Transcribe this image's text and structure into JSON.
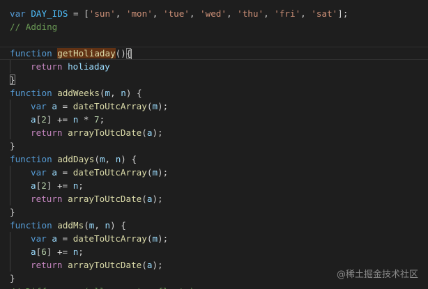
{
  "editor": {
    "language": "javascript",
    "theme": {
      "background": "#1e1e1e",
      "keyword": "#569cd6",
      "function": "#dcdcaa",
      "variable": "#9cdcfe",
      "constant": "#4fc1ff",
      "string": "#ce9178",
      "number": "#b5cea8",
      "comment": "#6a9955"
    },
    "lines": [
      [
        [
          "kw",
          "var"
        ],
        [
          "pun",
          " "
        ],
        [
          "const",
          "DAY_IDS"
        ],
        [
          "pun",
          " = ["
        ],
        [
          "str",
          "'sun'"
        ],
        [
          "pun",
          ", "
        ],
        [
          "str",
          "'mon'"
        ],
        [
          "pun",
          ", "
        ],
        [
          "str",
          "'tue'"
        ],
        [
          "pun",
          ", "
        ],
        [
          "str",
          "'wed'"
        ],
        [
          "pun",
          ", "
        ],
        [
          "str",
          "'thu'"
        ],
        [
          "pun",
          ", "
        ],
        [
          "str",
          "'fri'"
        ],
        [
          "pun",
          ", "
        ],
        [
          "str",
          "'sat'"
        ],
        [
          "pun",
          "];"
        ]
      ],
      [
        [
          "cmt",
          "// Adding"
        ]
      ],
      [],
      [
        [
          "kw",
          "function"
        ],
        [
          "pun",
          " "
        ],
        [
          "fn sel-word",
          "getHoliaday"
        ],
        [
          "pun",
          "()"
        ],
        [
          "pun bracket-match",
          "{"
        ],
        [
          "cursor",
          ""
        ]
      ],
      [
        [
          "indent",
          ""
        ],
        [
          "ctl",
          "return"
        ],
        [
          "pun",
          " "
        ],
        [
          "var",
          "holiaday"
        ]
      ],
      [
        [
          "pun bracket-match",
          "}"
        ]
      ],
      [
        [
          "kw",
          "function"
        ],
        [
          "pun",
          " "
        ],
        [
          "fn",
          "addWeeks"
        ],
        [
          "pun",
          "("
        ],
        [
          "var",
          "m"
        ],
        [
          "pun",
          ", "
        ],
        [
          "var",
          "n"
        ],
        [
          "pun",
          ") {"
        ]
      ],
      [
        [
          "indent",
          ""
        ],
        [
          "kw",
          "var"
        ],
        [
          "pun",
          " "
        ],
        [
          "var",
          "a"
        ],
        [
          "pun",
          " = "
        ],
        [
          "fn",
          "dateToUtcArray"
        ],
        [
          "pun",
          "("
        ],
        [
          "var",
          "m"
        ],
        [
          "pun",
          ");"
        ]
      ],
      [
        [
          "indent",
          ""
        ],
        [
          "var",
          "a"
        ],
        [
          "pun",
          "["
        ],
        [
          "num",
          "2"
        ],
        [
          "pun",
          "] += "
        ],
        [
          "var",
          "n"
        ],
        [
          "pun",
          " * "
        ],
        [
          "num",
          "7"
        ],
        [
          "pun",
          ";"
        ]
      ],
      [
        [
          "indent",
          ""
        ],
        [
          "ctl",
          "return"
        ],
        [
          "pun",
          " "
        ],
        [
          "fn",
          "arrayToUtcDate"
        ],
        [
          "pun",
          "("
        ],
        [
          "var",
          "a"
        ],
        [
          "pun",
          ");"
        ]
      ],
      [
        [
          "pun",
          "}"
        ]
      ],
      [
        [
          "kw",
          "function"
        ],
        [
          "pun",
          " "
        ],
        [
          "fn",
          "addDays"
        ],
        [
          "pun",
          "("
        ],
        [
          "var",
          "m"
        ],
        [
          "pun",
          ", "
        ],
        [
          "var",
          "n"
        ],
        [
          "pun",
          ") {"
        ]
      ],
      [
        [
          "indent",
          ""
        ],
        [
          "kw",
          "var"
        ],
        [
          "pun",
          " "
        ],
        [
          "var",
          "a"
        ],
        [
          "pun",
          " = "
        ],
        [
          "fn",
          "dateToUtcArray"
        ],
        [
          "pun",
          "("
        ],
        [
          "var",
          "m"
        ],
        [
          "pun",
          ");"
        ]
      ],
      [
        [
          "indent",
          ""
        ],
        [
          "var",
          "a"
        ],
        [
          "pun",
          "["
        ],
        [
          "num",
          "2"
        ],
        [
          "pun",
          "] += "
        ],
        [
          "var",
          "n"
        ],
        [
          "pun",
          ";"
        ]
      ],
      [
        [
          "indent",
          ""
        ],
        [
          "ctl",
          "return"
        ],
        [
          "pun",
          " "
        ],
        [
          "fn",
          "arrayToUtcDate"
        ],
        [
          "pun",
          "("
        ],
        [
          "var",
          "a"
        ],
        [
          "pun",
          ");"
        ]
      ],
      [
        [
          "pun",
          "}"
        ]
      ],
      [
        [
          "kw",
          "function"
        ],
        [
          "pun",
          " "
        ],
        [
          "fn",
          "addMs"
        ],
        [
          "pun",
          "("
        ],
        [
          "var",
          "m"
        ],
        [
          "pun",
          ", "
        ],
        [
          "var",
          "n"
        ],
        [
          "pun",
          ") {"
        ]
      ],
      [
        [
          "indent",
          ""
        ],
        [
          "kw",
          "var"
        ],
        [
          "pun",
          " "
        ],
        [
          "var",
          "a"
        ],
        [
          "pun",
          " = "
        ],
        [
          "fn",
          "dateToUtcArray"
        ],
        [
          "pun",
          "("
        ],
        [
          "var",
          "m"
        ],
        [
          "pun",
          ");"
        ]
      ],
      [
        [
          "indent",
          ""
        ],
        [
          "var",
          "a"
        ],
        [
          "pun",
          "["
        ],
        [
          "num",
          "6"
        ],
        [
          "pun",
          "] += "
        ],
        [
          "var",
          "n"
        ],
        [
          "pun",
          ";"
        ]
      ],
      [
        [
          "indent",
          ""
        ],
        [
          "ctl",
          "return"
        ],
        [
          "pun",
          " "
        ],
        [
          "fn",
          "arrayToUtcDate"
        ],
        [
          "pun",
          "("
        ],
        [
          "var",
          "a"
        ],
        [
          "pun",
          ");"
        ]
      ],
      [
        [
          "pun",
          "}"
        ]
      ]
    ],
    "current_line": 3,
    "cut_line_text": "// Difference (all are utc, floats)"
  },
  "watermark": {
    "text": "@稀土掘金技术社区"
  }
}
